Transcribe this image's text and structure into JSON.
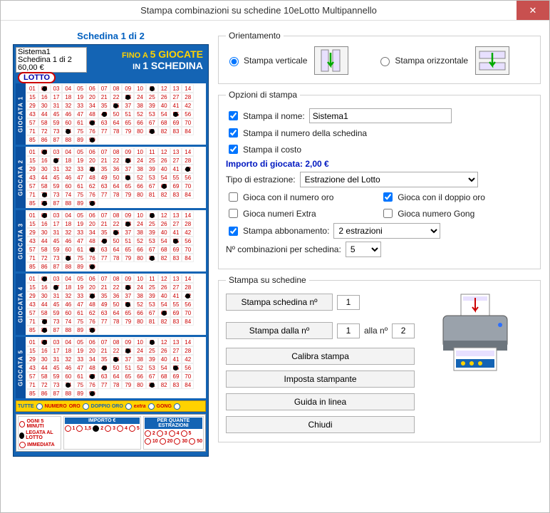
{
  "window": {
    "title": "Stampa combinazioni su schedine 10eLotto Multipannello"
  },
  "ticket": {
    "caption": "Schedina 1 di 2",
    "info_l1": "Sistema1",
    "info_l2": "Schedina 1 di 2",
    "info_l3": "60,00 €",
    "fino_a": "FINO A",
    "giocate": "5 GIOCATE",
    "in": "IN",
    "schedina": "1 SCHEDINA",
    "lotto": "LOTTO",
    "giocata_labels": [
      "GIOCATA 1",
      "GIOCATA 2",
      "GIOCATA 3",
      "GIOCATA 4",
      "GIOCATA 5"
    ],
    "marks": [
      [
        2,
        11,
        23,
        36,
        49,
        55,
        62,
        74,
        81,
        90
      ],
      [
        2,
        17,
        23,
        34,
        42,
        51,
        68,
        72,
        86,
        90
      ],
      [
        2,
        11,
        23,
        36,
        49,
        55,
        62,
        74,
        81,
        90
      ],
      [
        2,
        17,
        23,
        34,
        42,
        51,
        68,
        72,
        86,
        90
      ],
      [
        2,
        11,
        23,
        36,
        49,
        55,
        62,
        74,
        81,
        90
      ]
    ],
    "strip": {
      "tutte": "TUTTE",
      "numero_oro": "NUMERO",
      "oro": "ORO",
      "doppio": "DOPPIO ORO",
      "extra": "extra",
      "gong": "GONG"
    },
    "footer": {
      "col1_h": "",
      "col1": [
        "OGNI 5 MINUTI",
        "LEGATA AL LOTTO",
        "IMMEDIATA"
      ],
      "col2_h": "IMPORTO €",
      "col2": [
        "1",
        "1,5",
        "2",
        "3",
        "4",
        "5"
      ],
      "col3_h": "PER QUANTE ESTRAZIONI",
      "col3": [
        "2",
        "3",
        "4",
        "5",
        "10",
        "20",
        "30",
        "50"
      ]
    }
  },
  "orient": {
    "legend": "Orientamento",
    "vertical": "Stampa verticale",
    "horizontal": "Stampa orizzontale",
    "selected": "vertical"
  },
  "options": {
    "legend": "Opzioni di stampa",
    "stampa_nome_label": "Stampa il nome:",
    "nome_value": "Sistema1",
    "stampa_numero": "Stampa il numero della schedina",
    "stampa_costo": "Stampa il costo",
    "importo_label": "Importo di giocata: 2,00 €",
    "tipo_estr_label": "Tipo di estrazione:",
    "tipo_estr_value": "Estrazione del Lotto",
    "numero_oro": "Gioca con il numero oro",
    "doppio_oro": "Gioca con il doppio oro",
    "numeri_extra": "Gioca numeri Extra",
    "numero_gong": "Gioca numero Gong",
    "abbonamento_label": "Stampa abbonamento:",
    "abbonamento_value": "2 estrazioni",
    "combinazioni_label": "Nº combinazioni per schedina:",
    "combinazioni_value": "5"
  },
  "schedine": {
    "legend": "Stampa su schedine",
    "stampa_n": "Stampa schedina nº",
    "stampa_n_value": "1",
    "dalla": "Stampa dalla nº",
    "dalla_value": "1",
    "alla": "alla nº",
    "alla_value": "2",
    "calibra": "Calibra stampa",
    "imposta": "Imposta stampante",
    "guida": "Guida in linea",
    "chiudi": "Chiudi"
  }
}
